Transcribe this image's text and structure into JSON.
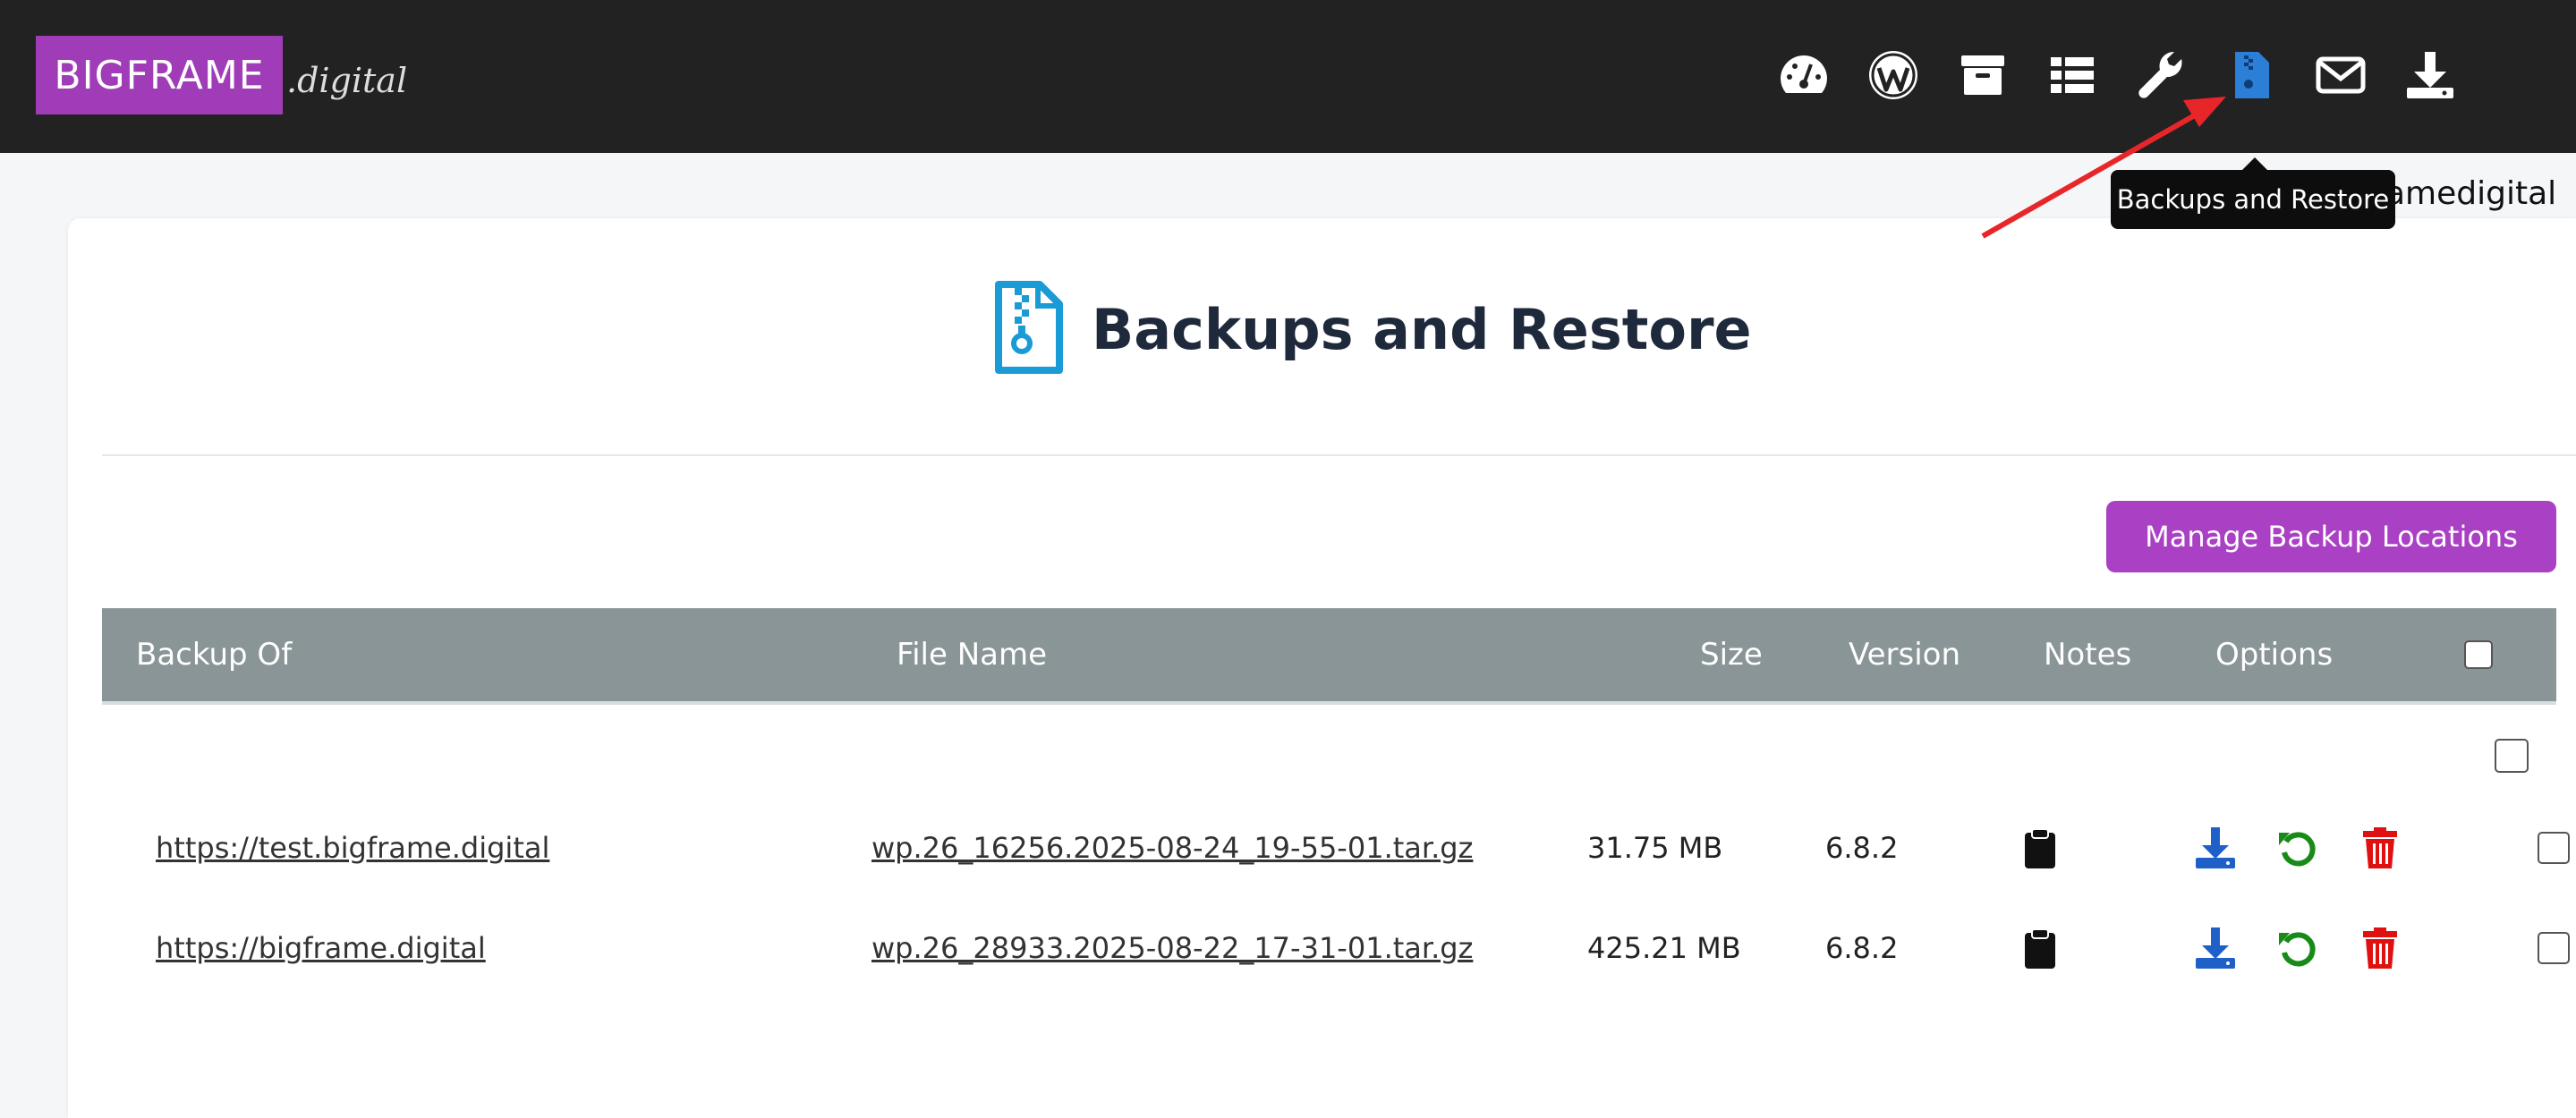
{
  "brand": {
    "logo_main": "BIGFRAME",
    "logo_suffix": ".digital",
    "accent": "#a03cb8"
  },
  "nav": {
    "icons": [
      "dashboard-icon",
      "wordpress-icon",
      "archive-icon",
      "list-icon",
      "wrench-icon",
      "file-zipper-icon",
      "envelope-icon",
      "download-icon"
    ],
    "active": "file-zipper-icon",
    "tooltip": "Backups and Restore",
    "user_fragment": "amedigital"
  },
  "page": {
    "title": "Backups and Restore",
    "manage_button": "Manage Backup Locations"
  },
  "table": {
    "headers": {
      "backup_of": "Backup Of",
      "file_name": "File Name",
      "size": "Size",
      "version": "Version",
      "notes": "Notes",
      "options": "Options"
    },
    "rows": [
      {
        "backup_of": "https://test.bigframe.digital",
        "file_name": "wp.26_16256.2025-08-24_19-55-01.tar.gz",
        "size": "31.75 MB",
        "version": "6.8.2"
      },
      {
        "backup_of": "https://bigframe.digital",
        "file_name": "wp.26_28933.2025-08-22_17-31-01.tar.gz",
        "size": "425.21 MB",
        "version": "6.8.2"
      }
    ]
  },
  "colors": {
    "header_bg": "#8a9597",
    "download": "#1f5fc8",
    "restore": "#188a18",
    "delete": "#e01010",
    "active_nav": "#2b7fd6"
  }
}
